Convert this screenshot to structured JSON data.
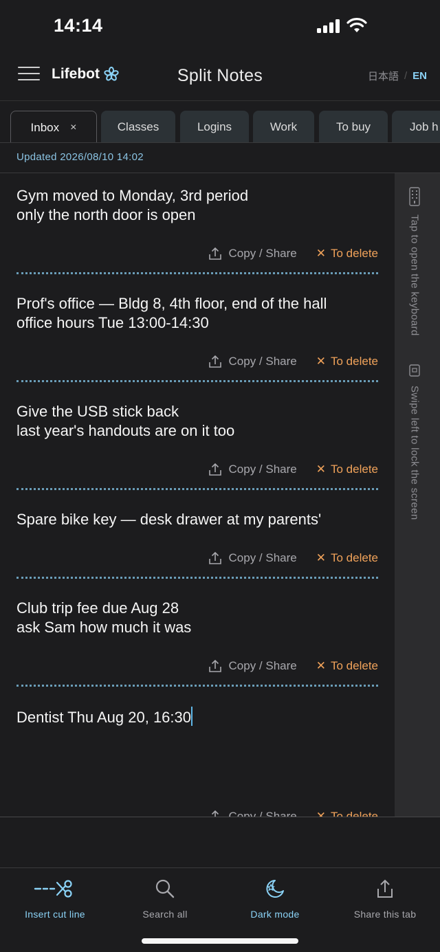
{
  "status_bar": {
    "time": "14:14"
  },
  "header": {
    "brand": "Lifebot",
    "title": "Split Notes",
    "lang_ja": "日本語",
    "lang_sep": "/",
    "lang_en": "EN"
  },
  "tabs": [
    {
      "label": "Inbox",
      "close": "×"
    },
    {
      "label": "Classes"
    },
    {
      "label": "Logins"
    },
    {
      "label": "Work"
    },
    {
      "label": "To buy"
    },
    {
      "label": "Job h"
    }
  ],
  "updated": "Updated 2026/08/10 14:02",
  "notes": [
    {
      "text": "Gym moved to Monday, 3rd period\nonly the north door is open"
    },
    {
      "text": "Prof's office — Bldg 8, 4th floor, end of the hall\noffice hours Tue 13:00-14:30"
    },
    {
      "text": "Give the USB stick back\nlast year's handouts are on it too"
    },
    {
      "text": "Spare bike key — desk drawer at my parents'"
    },
    {
      "text": "Club trip fee due Aug 28\nask Sam how much it was"
    },
    {
      "text": "Dentist Thu Aug 20, 16:30"
    }
  ],
  "note_actions": {
    "copy_share": "Copy / Share",
    "to_delete": "To delete",
    "x": "✕"
  },
  "side_hints": {
    "keyboard": "Tap to open the keyboard",
    "lock": "Swipe left to lock the screen"
  },
  "toolbar": [
    {
      "label": "Insert cut line",
      "icon": "scissors-cut-line-icon",
      "color": "#8bd3f7"
    },
    {
      "label": "Search all",
      "icon": "search-icon",
      "color": "#a8a8ad"
    },
    {
      "label": "Dark mode",
      "icon": "moon-star-icon",
      "color": "#8bd3f7"
    },
    {
      "label": "Share this tab",
      "icon": "share-icon",
      "color": "#a8a8ad"
    }
  ],
  "colors": {
    "accent": "#8bd3f7",
    "delete": "#f0a25a",
    "background": "#1c1c1e"
  }
}
